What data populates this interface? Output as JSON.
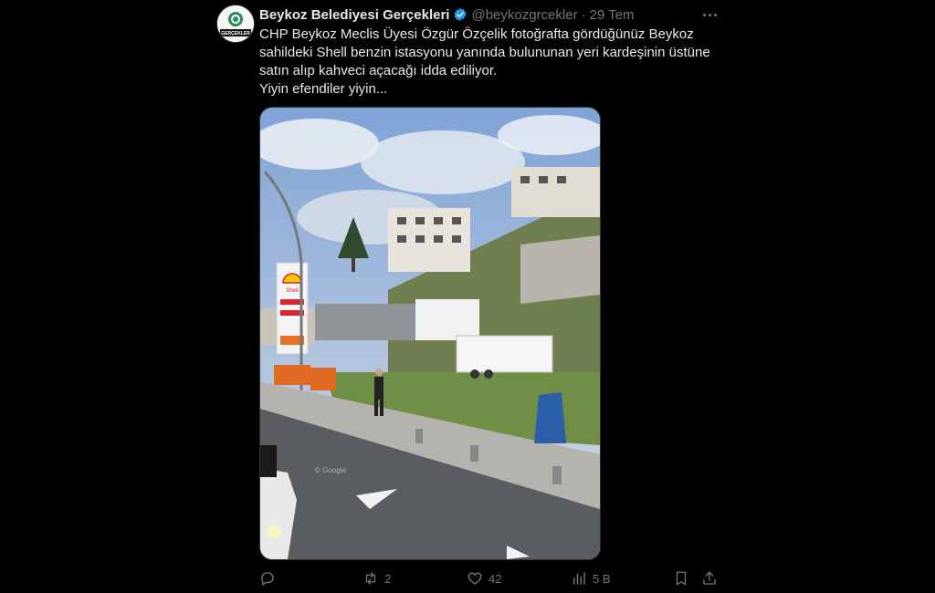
{
  "tweet": {
    "author_name": "Beykoz Belediyesi Gerçekleri",
    "handle": "@beykozgrcekler",
    "separator": "·",
    "time": "29 Tem",
    "avatar_text": "GERÇEKLER",
    "text_lines": [
      "CHP Beykoz Meclis Üyesi Özgür Özçelik fotoğrafta gördüğünüz Beykoz",
      "sahildeki Shell benzin istasyonu yanında bulununan yeri kardeşinin üstüne",
      "satın alıp kahveci açacağı idda ediliyor.",
      "Yiyin efendiler yiyin..."
    ]
  },
  "photo": {
    "shell_logo_text": "Shell",
    "watermark": "© Google"
  },
  "actions": {
    "replies": "",
    "retweets": "2",
    "likes": "42",
    "views": "5 B"
  },
  "colors": {
    "background": "#000000",
    "text": "#e7e9ea",
    "muted": "#71767b",
    "verified": "#1d9bf0"
  },
  "icons": [
    "verified-badge-icon",
    "more-icon",
    "reply-icon",
    "retweet-icon",
    "like-icon",
    "views-icon",
    "bookmark-icon",
    "share-icon"
  ]
}
